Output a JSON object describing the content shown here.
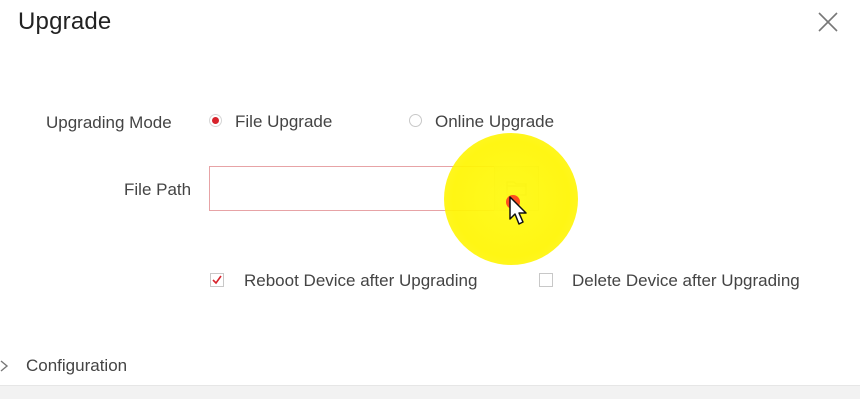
{
  "dialog": {
    "title": "Upgrade"
  },
  "upgrade_mode": {
    "label": "Upgrading Mode",
    "options": [
      {
        "label": "File Upgrade",
        "selected": true
      },
      {
        "label": "Online Upgrade",
        "selected": false
      }
    ]
  },
  "file_path": {
    "label": "File Path",
    "value": "",
    "placeholder": ""
  },
  "options": {
    "reboot": {
      "label": "Reboot Device after Upgrading",
      "checked": true
    },
    "delete": {
      "label": "Delete Device after Upgrading",
      "checked": false
    }
  },
  "configuration": {
    "label": "Configuration",
    "expanded": false
  },
  "icons": {
    "close": "close-icon",
    "browse": "folder-icon",
    "expander": "chevron-right-icon",
    "check": "check-icon",
    "cursor": "mouse-pointer-icon"
  },
  "colors": {
    "accent": "#d7232c",
    "input_border": "#e7a3a6",
    "highlight": "#fff500"
  }
}
